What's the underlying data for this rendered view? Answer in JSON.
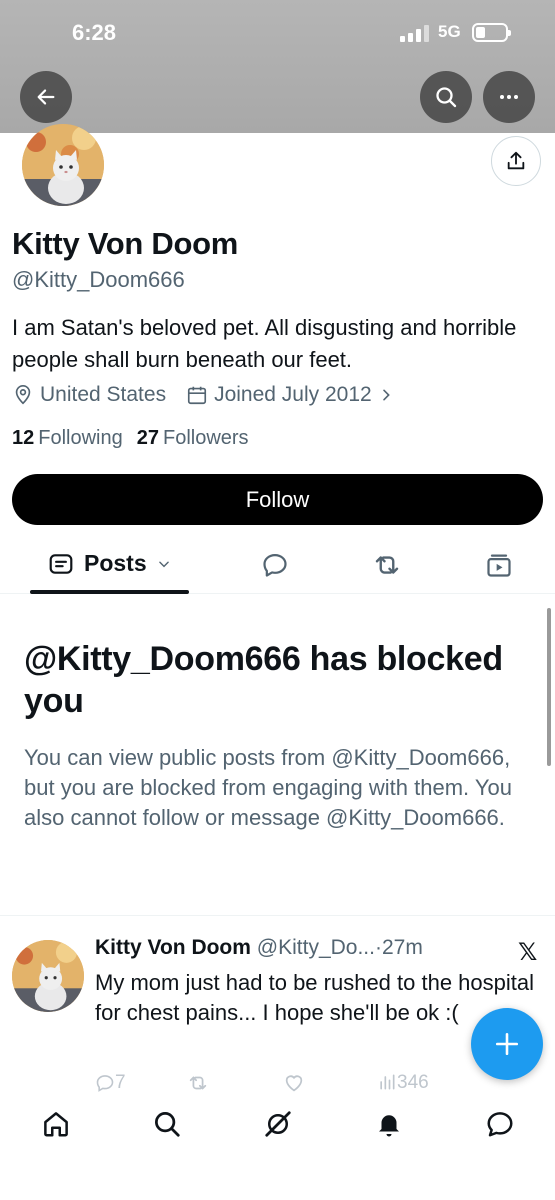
{
  "status_bar": {
    "time": "6:28",
    "network": "5G"
  },
  "profile": {
    "display_name": "Kitty Von Doom",
    "handle": "@Kitty_Doom666",
    "bio": "I am Satan's beloved pet. All disgusting and horrible people shall burn beneath our feet.",
    "location": "United States",
    "joined": "Joined July 2012",
    "following_count": "12",
    "following_label": "Following",
    "followers_count": "27",
    "followers_label": "Followers",
    "follow_button": "Follow"
  },
  "tabs": {
    "posts_label": "Posts"
  },
  "blocked": {
    "title": "@Kitty_Doom666 has blocked you",
    "message": "You can view public posts from @Kitty_Doom666, but you are blocked from engaging with them. You also cannot follow or message @Kitty_Doom666."
  },
  "tweet": {
    "name": "Kitty Von Doom",
    "handle": "@Kitty_Do...",
    "time": "27m",
    "text": "My mom just had to be rushed to the hospital for chest pains... I hope she'll be ok :(",
    "replies": "7",
    "views": "346"
  },
  "colors": {
    "accent": "#1d9bf0",
    "text": "#0f1419",
    "secondary": "#536471"
  }
}
